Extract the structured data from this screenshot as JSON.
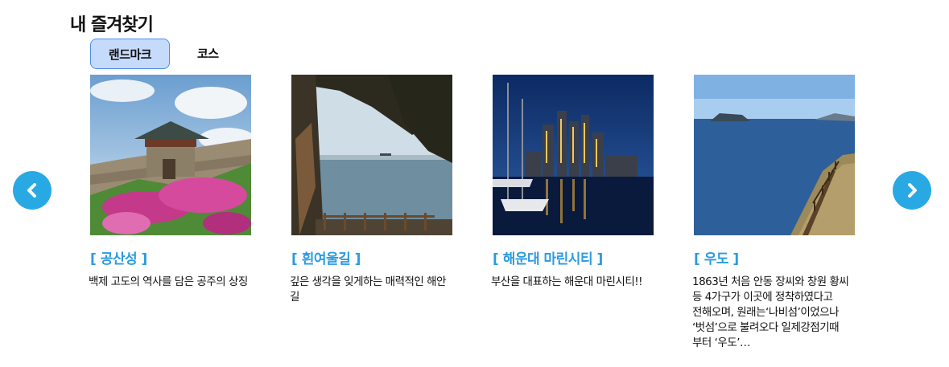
{
  "page": {
    "title": "내 즐겨찾기"
  },
  "tabs": [
    {
      "label": "랜드마크",
      "active": true
    },
    {
      "label": "코스",
      "active": false
    }
  ],
  "nav": {
    "prev_icon": "chevron-left-icon",
    "next_icon": "chevron-right-icon",
    "accent": "#29a9e4"
  },
  "cards": [
    {
      "name": "[ 공산성 ]",
      "description": "백제 고도의 역사를 담은 공주의 상징"
    },
    {
      "name": "[ 흰여울길 ]",
      "description": "깊은 생각을 잊게하는 매력적인 해안 길"
    },
    {
      "name": "[ 해운대 마린시티 ]",
      "description": "부산을 대표하는 해운대 마린시티!!"
    },
    {
      "name": "[ 우도 ]",
      "description": "1863년 처음 안동 장씨와 창원 황씨 등 4가구가 이곳에 정착하였다고 전해오며, 원래는‘나비섬’이었으나 ‘벗섬’으로 불려오다 일제강점기때 부터 ‘우도’…"
    }
  ]
}
